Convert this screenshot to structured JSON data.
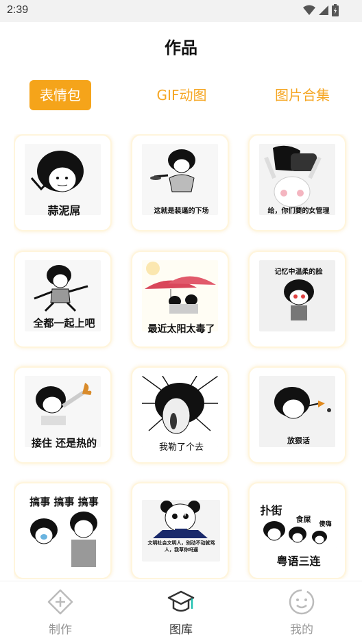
{
  "status_bar": {
    "time": "2:39",
    "icons": [
      "wifi-icon",
      "cell-signal-icon",
      "battery-icon"
    ]
  },
  "page": {
    "title": "作品"
  },
  "tabs": [
    {
      "label": "表情包",
      "active": true
    },
    {
      "label": "GIF动图",
      "active": false
    },
    {
      "label": "图片合集",
      "active": false
    }
  ],
  "colors": {
    "accent": "#f5a41a",
    "tab_inactive": "#f5a623",
    "card_border": "#fff5dc",
    "nav_inactive": "#999999",
    "nav_active": "#333333"
  },
  "memes": [
    {
      "caption": "蒜泥屌"
    },
    {
      "caption": "这就是装逼的下场"
    },
    {
      "caption": "给，你们要的女管理"
    },
    {
      "caption": "全都一起上吧"
    },
    {
      "caption": "最近太阳太毒了"
    },
    {
      "caption": "记忆中温柔的脸"
    },
    {
      "caption": "接住 还是热的"
    },
    {
      "caption": "我勒了个去"
    },
    {
      "caption": "放狠话"
    },
    {
      "caption": "搞事 搞事 搞事"
    },
    {
      "caption": "文明社会文明人，别动不动就骂人，我草你吗逼",
      "badge": "熊猫"
    },
    {
      "caption": "扑街",
      "caption2": "食屎",
      "caption3": "傻嗨",
      "caption4": "粤语三连"
    }
  ],
  "bottom_nav": [
    {
      "label": "制作",
      "icon": "create-icon",
      "active": false
    },
    {
      "label": "图库",
      "icon": "gallery-icon",
      "active": true
    },
    {
      "label": "我的",
      "icon": "profile-icon",
      "active": false
    }
  ]
}
